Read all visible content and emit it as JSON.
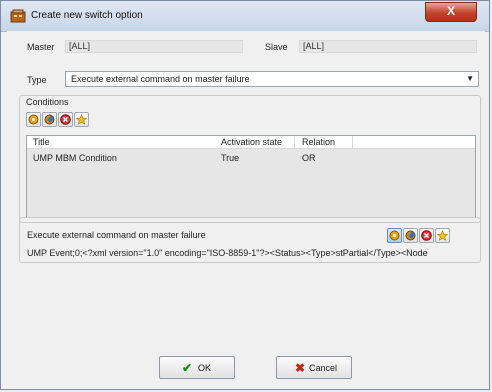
{
  "window": {
    "title": "Create new switch option",
    "close_label": "X"
  },
  "master": {
    "label": "Master",
    "value": "[ALL]"
  },
  "slave": {
    "label": "Slave",
    "value": "[ALL]"
  },
  "type": {
    "label": "Type",
    "selected": "Execute external command on master failure"
  },
  "conditions": {
    "label": "Conditions",
    "columns": [
      "Title",
      "Activation state",
      "Relation"
    ],
    "rows": [
      {
        "title": "UMP MBM Condition",
        "activation_state": "True",
        "relation": "OR"
      }
    ]
  },
  "command": {
    "label": "Execute external command on master failure",
    "value": "UMP Event;0;<?xml version=\"1.0\" encoding=\"ISO-8859-1\"?><Status><Type>stPartial</Type><Node"
  },
  "buttons": {
    "ok": "OK",
    "cancel": "Cancel"
  },
  "colors": {
    "ok_check": "#1e8a1e",
    "cancel_x": "#c0261a",
    "close_button": "#c2432a"
  }
}
